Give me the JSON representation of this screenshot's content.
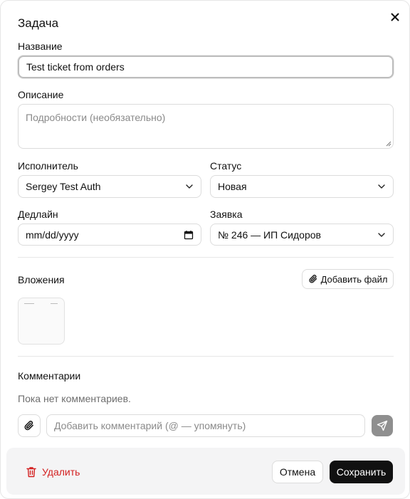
{
  "dialog": {
    "title": "Задача"
  },
  "form": {
    "name_label": "Название",
    "name_value": "Test ticket from orders",
    "description_label": "Описание",
    "description_placeholder": "Подробности (необязательно)",
    "assignee_label": "Исполнитель",
    "assignee_value": "Sergey Test Auth",
    "status_label": "Статус",
    "status_value": "Новая",
    "deadline_label": "Дедлайн",
    "deadline_value": "mm/dd/yyyy",
    "request_label": "Заявка",
    "request_value": "№ 246 — ИП Сидоров"
  },
  "attachments": {
    "label": "Вложения",
    "add_button": "Добавить файл"
  },
  "comments": {
    "label": "Комментарии",
    "empty_text": "Пока нет комментариев.",
    "input_placeholder": "Добавить комментарий (@ — упомянуть)"
  },
  "footer": {
    "delete_label": "Удалить",
    "cancel_label": "Отмена",
    "save_label": "Сохранить"
  },
  "colors": {
    "danger": "#d32020",
    "primary": "#111111",
    "send_button": "#8f8f8f",
    "footer_bg": "#f4f4f5"
  },
  "icons": {
    "close": "close-icon",
    "chevron": "chevron-down-icon",
    "calendar": "calendar-icon",
    "paperclip": "paperclip-icon",
    "send": "send-icon",
    "trash": "trash-icon"
  }
}
